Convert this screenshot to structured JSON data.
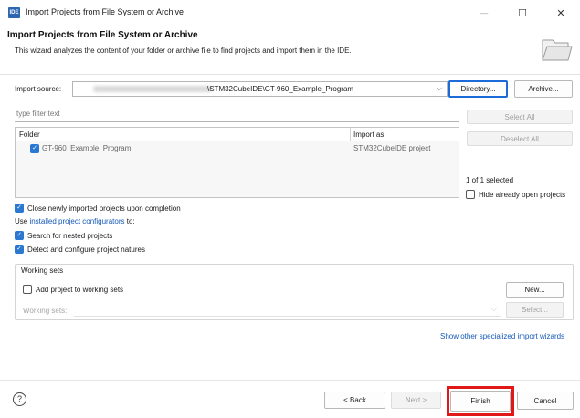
{
  "window": {
    "app_icon_text": "IDE",
    "title": "Import Projects from File System or Archive",
    "minimize_glyph": "—",
    "maximize_glyph": "☐",
    "close_glyph": "✕"
  },
  "header": {
    "title": "Import Projects from File System or Archive",
    "description": "This wizard analyzes the content of your folder or archive file to find projects and import them in the IDE."
  },
  "import_source": {
    "label": "Import source:",
    "value": "\\STM32CubeIDE\\GT-960_Example_Program",
    "directory_button": "Directory...",
    "archive_button": "Archive..."
  },
  "filter": {
    "placeholder": "type filter text"
  },
  "table": {
    "headers": [
      "Folder",
      "Import as"
    ],
    "rows": [
      {
        "folder": "GT-960_Example_Program",
        "import_as": "STM32CubeIDE project",
        "checked": true
      }
    ]
  },
  "side_panel": {
    "select_all": "Select All",
    "deselect_all": "Deselect All",
    "selected_count": "1 of 1 selected",
    "hide_open_projects": "Hide already open projects"
  },
  "options": {
    "close_imported": "Close newly imported projects upon completion",
    "use_prefix": "Use ",
    "configurators_link": "installed project configurators",
    "use_suffix": " to:",
    "search_nested": "Search for nested projects",
    "detect_natures": "Detect and configure project natures"
  },
  "working_sets": {
    "legend": "Working sets",
    "add_label": "Add project to working sets",
    "new_button": "New...",
    "sets_label": "Working sets:",
    "select_button": "Select..."
  },
  "other_wizards_link": "Show other specialized import wizards",
  "footer": {
    "help_glyph": "?",
    "back_button": "< Back",
    "next_button": "Next >",
    "finish_button": "Finish",
    "cancel_button": "Cancel"
  },
  "colors": {
    "accent": "#2b78d0",
    "highlight": "#e01818",
    "link": "#1458b8"
  }
}
